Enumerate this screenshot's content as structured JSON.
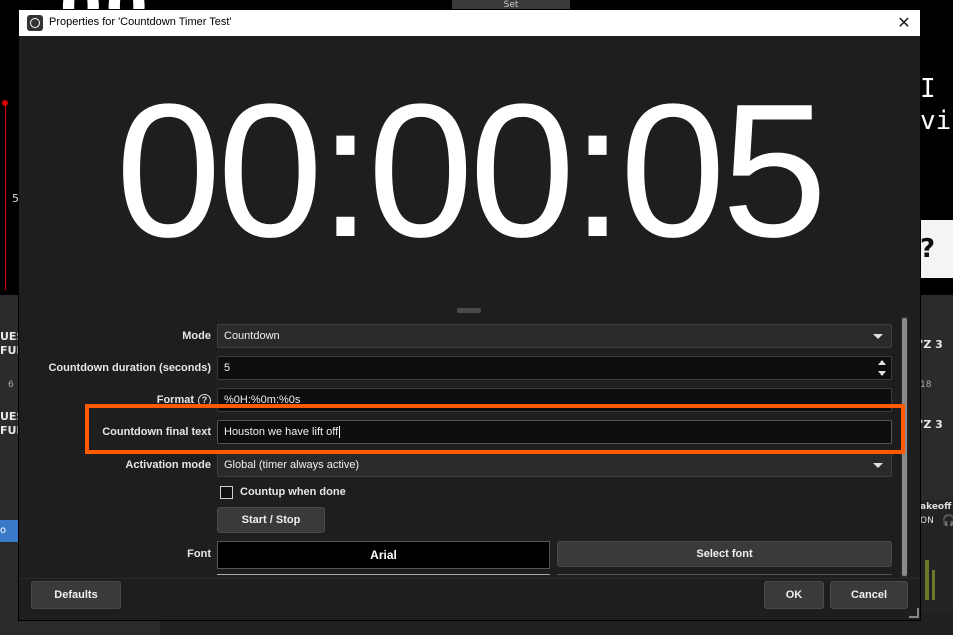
{
  "background": {
    "top_button": "Set",
    "big_digits": "00",
    "left_number": "5",
    "left_rows": [
      {
        "line1": "UES",
        "line2": "FUL"
      },
      {
        "line1": "UES",
        "line2": "FUL"
      }
    ],
    "left_small": "6",
    "left_blue": "o",
    "right_letter_1": "I",
    "right_letter_2": "vi",
    "right_box_text": "? M",
    "right_rows": [
      "'Z 3",
      "'Z 3"
    ],
    "right_small": "18",
    "right_mixer_title": "akeoff",
    "right_mixer_sub": "ON"
  },
  "dialog": {
    "title": "Properties for 'Countdown Timer Test'",
    "close_glyph": "✕",
    "timer_display": "00:00:05",
    "properties": {
      "mode": {
        "label": "Mode",
        "value": "Countdown"
      },
      "duration": {
        "label": "Countdown duration (seconds)",
        "value": "5"
      },
      "format": {
        "label": "Format",
        "value": "%0H:%0m:%0s"
      },
      "final_text": {
        "label": "Countdown final text",
        "value": "Houston we have lift  off"
      },
      "activation": {
        "label": "Activation mode",
        "value": "Global (timer always active)"
      },
      "countup": {
        "label": "Countup when done",
        "checked": false
      },
      "start_stop": "Start / Stop",
      "font": {
        "label": "Font",
        "preview": "Arial",
        "select_button": "Select font"
      }
    },
    "buttons": {
      "defaults": "Defaults",
      "ok": "OK",
      "cancel": "Cancel"
    }
  },
  "highlight_color": "#ff5a00"
}
